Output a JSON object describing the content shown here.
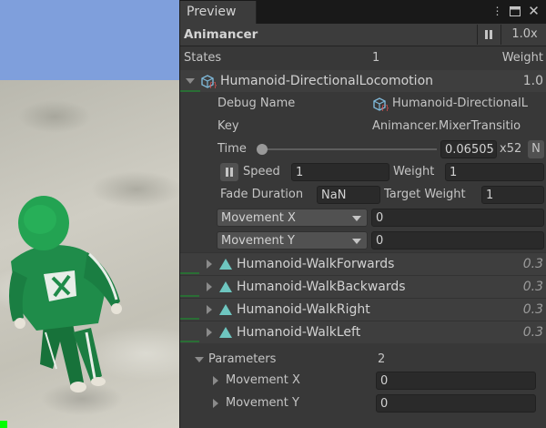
{
  "tab": {
    "label": "Preview"
  },
  "toolbar": {
    "title": "Animancer",
    "speed": "1.0x"
  },
  "header": {
    "states": "States",
    "count": "1",
    "weight": "Weight"
  },
  "mixer": {
    "name": "Humanoid-DirectionalLocomotion",
    "weight": "1.0",
    "debug_name_label": "Debug Name",
    "debug_name_value": "Humanoid-DirectionalL",
    "key_label": "Key",
    "key_value": "Animancer.MixerTransitio",
    "time_label": "Time",
    "time_value": "0.06505",
    "time_mult": "x52",
    "time_n": "N",
    "time_fraction": 0.02,
    "speed_label": "Speed",
    "speed_value": "1",
    "weight_label": "Weight",
    "weight_value": "1",
    "fade_label": "Fade Duration",
    "fade_value": "NaN",
    "target_label": "Target Weight",
    "target_value": "1",
    "param_x_option": "Movement X",
    "param_x_value": "0",
    "param_y_option": "Movement Y",
    "param_y_value": "0"
  },
  "children": [
    {
      "name": "Humanoid-WalkForwards",
      "weight": "0.3"
    },
    {
      "name": "Humanoid-WalkBackwards",
      "weight": "0.3"
    },
    {
      "name": "Humanoid-WalkRight",
      "weight": "0.3"
    },
    {
      "name": "Humanoid-WalkLeft",
      "weight": "0.3"
    }
  ],
  "parameters": {
    "label": "Parameters",
    "count": "2",
    "items": [
      {
        "name": "Movement X",
        "value": "0"
      },
      {
        "name": "Movement Y",
        "value": "0"
      }
    ]
  },
  "colors": {
    "accent_green": "#2a6e35",
    "sky": "#7f9fdc",
    "character": "#1f8c4a"
  }
}
